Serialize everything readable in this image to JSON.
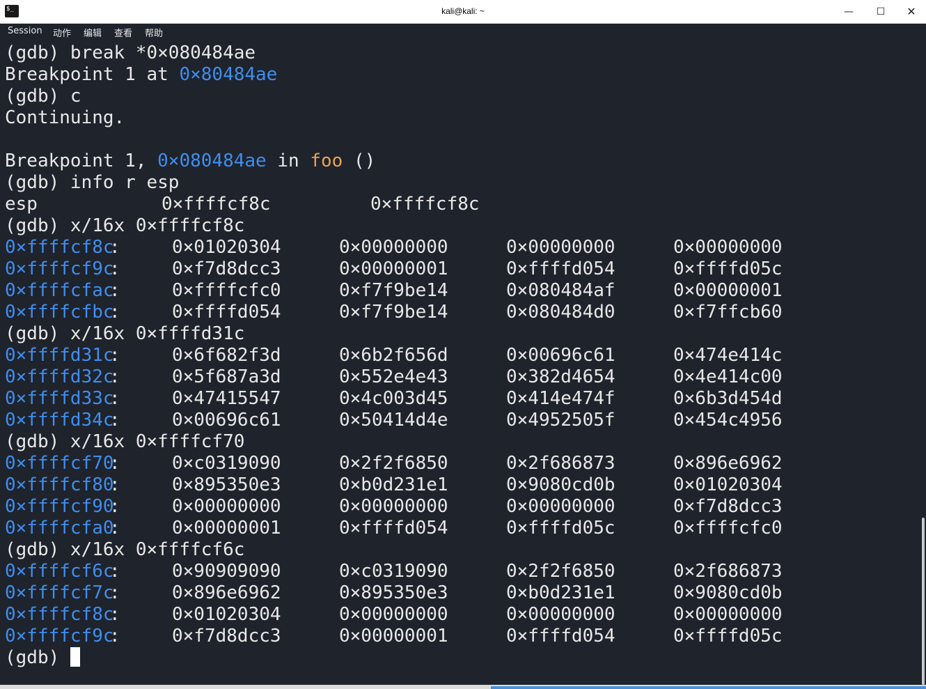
{
  "window": {
    "title": "kali@kali: ~",
    "icon": "terminal-icon",
    "icon_glyph": "$_",
    "controls": {
      "minimize": "—",
      "maximize": "☐",
      "close": "✕"
    }
  },
  "menu": [
    "Session",
    "动作",
    "编辑",
    "查看",
    "帮助"
  ],
  "colors": {
    "background": "#1f232b",
    "text": "#e8e8e8",
    "address": "#3e8ef0",
    "function": "#e9a352"
  },
  "terminal": {
    "lines": [
      {
        "type": "plain",
        "text": "(gdb) break *0×080484ae"
      },
      {
        "type": "bp_set",
        "pre": "Breakpoint 1 at ",
        "addr": "0×80484ae"
      },
      {
        "type": "plain",
        "text": "(gdb) c"
      },
      {
        "type": "plain",
        "text": "Continuing."
      },
      {
        "type": "plain",
        "text": ""
      },
      {
        "type": "bp_hit",
        "pre": "Breakpoint 1, ",
        "addr": "0×080484ae",
        "mid": " in ",
        "func": "foo",
        "post": " ()"
      },
      {
        "type": "plain",
        "text": "(gdb) info r esp"
      },
      {
        "type": "reg",
        "name": "esp",
        "hex": "0×ffffcf8c",
        "val": "0×ffffcf8c"
      },
      {
        "type": "plain",
        "text": "(gdb) x/16x 0×ffffcf8c"
      },
      {
        "type": "mem",
        "addr": "0×ffffcf8c",
        "words": [
          "0×01020304",
          "0×00000000",
          "0×00000000",
          "0×00000000"
        ]
      },
      {
        "type": "mem",
        "addr": "0×ffffcf9c",
        "words": [
          "0×f7d8dcc3",
          "0×00000001",
          "0×ffffd054",
          "0×ffffd05c"
        ]
      },
      {
        "type": "mem",
        "addr": "0×ffffcfac",
        "words": [
          "0×ffffcfc0",
          "0×f7f9be14",
          "0×080484af",
          "0×00000001"
        ]
      },
      {
        "type": "mem",
        "addr": "0×ffffcfbc",
        "words": [
          "0×ffffd054",
          "0×f7f9be14",
          "0×080484d0",
          "0×f7ffcb60"
        ]
      },
      {
        "type": "plain",
        "text": "(gdb) x/16x 0×ffffd31c"
      },
      {
        "type": "mem",
        "addr": "0×ffffd31c",
        "words": [
          "0×6f682f3d",
          "0×6b2f656d",
          "0×00696c61",
          "0×474e414c"
        ]
      },
      {
        "type": "mem",
        "addr": "0×ffffd32c",
        "words": [
          "0×5f687a3d",
          "0×552e4e43",
          "0×382d4654",
          "0×4e414c00"
        ]
      },
      {
        "type": "mem",
        "addr": "0×ffffd33c",
        "words": [
          "0×47415547",
          "0×4c003d45",
          "0×414e474f",
          "0×6b3d454d"
        ]
      },
      {
        "type": "mem",
        "addr": "0×ffffd34c",
        "words": [
          "0×00696c61",
          "0×50414d4e",
          "0×4952505f",
          "0×454c4956"
        ]
      },
      {
        "type": "plain",
        "text": "(gdb) x/16x 0×ffffcf70"
      },
      {
        "type": "mem",
        "addr": "0×ffffcf70",
        "words": [
          "0×c0319090",
          "0×2f2f6850",
          "0×2f686873",
          "0×896e6962"
        ]
      },
      {
        "type": "mem",
        "addr": "0×ffffcf80",
        "words": [
          "0×895350e3",
          "0×b0d231e1",
          "0×9080cd0b",
          "0×01020304"
        ]
      },
      {
        "type": "mem",
        "addr": "0×ffffcf90",
        "words": [
          "0×00000000",
          "0×00000000",
          "0×00000000",
          "0×f7d8dcc3"
        ]
      },
      {
        "type": "mem",
        "addr": "0×ffffcfa0",
        "words": [
          "0×00000001",
          "0×ffffd054",
          "0×ffffd05c",
          "0×ffffcfc0"
        ]
      },
      {
        "type": "plain",
        "text": "(gdb) x/16x 0×ffffcf6c"
      },
      {
        "type": "mem",
        "addr": "0×ffffcf6c",
        "words": [
          "0×90909090",
          "0×c0319090",
          "0×2f2f6850",
          "0×2f686873"
        ]
      },
      {
        "type": "mem",
        "addr": "0×ffffcf7c",
        "words": [
          "0×896e6962",
          "0×895350e3",
          "0×b0d231e1",
          "0×9080cd0b"
        ]
      },
      {
        "type": "mem",
        "addr": "0×ffffcf8c",
        "words": [
          "0×01020304",
          "0×00000000",
          "0×00000000",
          "0×00000000"
        ]
      },
      {
        "type": "mem",
        "addr": "0×ffffcf9c",
        "words": [
          "0×f7d8dcc3",
          "0×00000001",
          "0×ffffd054",
          "0×ffffd05c"
        ]
      },
      {
        "type": "prompt",
        "text": "(gdb) "
      }
    ]
  }
}
